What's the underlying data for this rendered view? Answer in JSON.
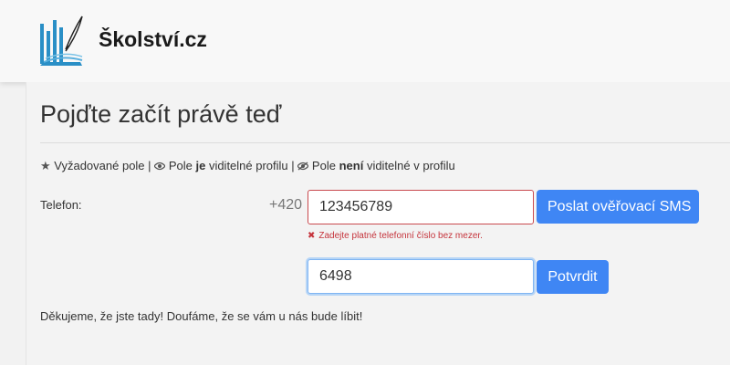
{
  "header": {
    "brand": "Školství.cz",
    "logo_icon": "school-logo-icon"
  },
  "page": {
    "title": "Pojďte začít právě teď"
  },
  "legend": {
    "required_icon": "star-icon",
    "required_text": "Vyžadované pole",
    "separator": "|",
    "visible_icon": "eye-icon",
    "visible_pre": "Pole",
    "visible_bold": "je",
    "visible_post": "viditelné profilu",
    "hidden_icon": "eye-slash-icon",
    "hidden_pre": "Pole",
    "hidden_bold": "není",
    "hidden_post": "viditelné v profilu"
  },
  "form": {
    "phone_label": "Telefon:",
    "prefix": "+420",
    "phone_value": "123456789",
    "send_sms_label": "Poslat ověřovací SMS",
    "error_icon": "x-icon",
    "error_text": "Zadejte platné telefonní číslo bez mezer.",
    "code_value": "6498",
    "confirm_label": "Potvrdit"
  },
  "footer": {
    "thanks": "Děkujeme, že jste tady! Doufáme, že se vám u nás bude líbit!"
  },
  "colors": {
    "primary": "#3f86f4",
    "error": "#c5343c",
    "logo_blue": "#2a8fc6"
  }
}
